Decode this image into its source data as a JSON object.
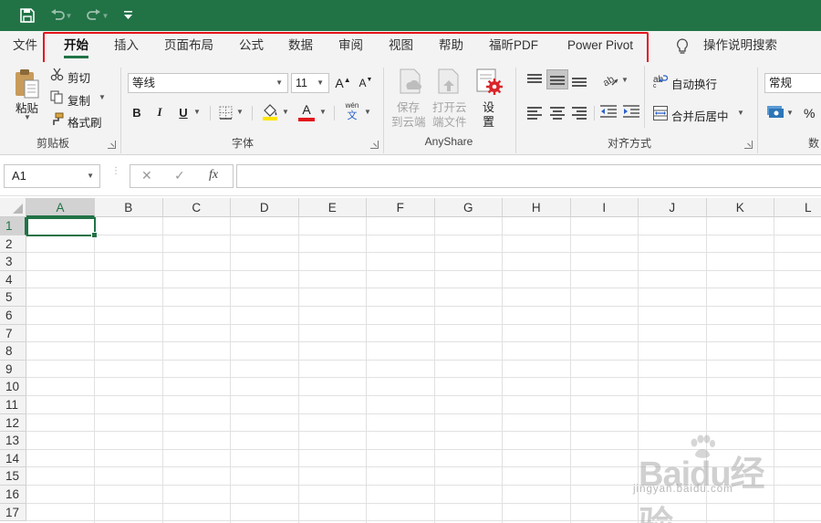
{
  "colors": {
    "brand": "#217346",
    "highlight": "#e3141b",
    "font_color_bar": "#e3141b",
    "fill_color_bar": "#ffe600"
  },
  "quick_access": {
    "save_icon": "save-icon",
    "undo_icon": "undo-icon",
    "redo_icon": "redo-icon",
    "customize_icon": "customize-qat-icon"
  },
  "tabs": [
    {
      "label": "文件"
    },
    {
      "label": "开始",
      "active": true
    },
    {
      "label": "插入"
    },
    {
      "label": "页面布局"
    },
    {
      "label": "公式"
    },
    {
      "label": "数据"
    },
    {
      "label": "审阅"
    },
    {
      "label": "视图"
    },
    {
      "label": "帮助"
    },
    {
      "label": "福昕PDF"
    },
    {
      "label": "Power Pivot"
    }
  ],
  "tell_me": {
    "label": "操作说明搜索",
    "icon": "lightbulb-icon"
  },
  "ribbon": {
    "clipboard": {
      "group_label": "剪贴板",
      "paste_label": "粘贴",
      "cut_label": "剪切",
      "copy_label": "复制",
      "format_painter_label": "格式刷"
    },
    "font": {
      "group_label": "字体",
      "font_name": "等线",
      "font_size": "11",
      "grow_label": "A",
      "shrink_label": "A",
      "bold_label": "B",
      "italic_label": "I",
      "underline_label": "U",
      "font_color_label": "A",
      "phonetic_top": "wén",
      "phonetic_bottom": "文"
    },
    "anyshare": {
      "group_label": "AnyShare",
      "save_line1": "保存",
      "save_line2": "到云端",
      "open_line1": "打开云",
      "open_line2": "端文件",
      "settings_label": "设",
      "settings_label2": "置"
    },
    "alignment": {
      "group_label": "对齐方式",
      "wrap_label": "自动换行",
      "merge_label": "合并后居中"
    },
    "number": {
      "group_label": "数",
      "format": "常规",
      "percent_label": "%"
    }
  },
  "formula_bar": {
    "name_box": "A1",
    "cancel": "✕",
    "enter": "✓",
    "fx": "fx",
    "value": ""
  },
  "sheet": {
    "columns": [
      "A",
      "B",
      "C",
      "D",
      "E",
      "F",
      "G",
      "H",
      "I",
      "J",
      "K",
      "L"
    ],
    "rows": [
      "1",
      "2",
      "3",
      "4",
      "5",
      "6",
      "7",
      "8",
      "9",
      "10",
      "11",
      "12",
      "13",
      "14",
      "15",
      "16",
      "17"
    ],
    "active_cell": "A1"
  },
  "watermark": {
    "big": "Baidu经验",
    "small": "jingyan.baidu.com"
  }
}
